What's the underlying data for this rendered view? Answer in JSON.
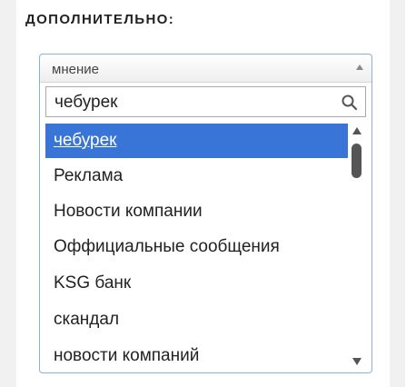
{
  "section": {
    "title": "дополнительно:"
  },
  "select": {
    "value": "мнение"
  },
  "search": {
    "value": "чебурек"
  },
  "results": [
    {
      "label": "чебурек",
      "highlighted": true
    },
    {
      "label": "Реклама"
    },
    {
      "label": "Новости компании"
    },
    {
      "label": "Оффициальные сообщения"
    },
    {
      "label": "KSG банк"
    },
    {
      "label": "скандал"
    },
    {
      "label": "новости компаний"
    }
  ],
  "icons": {
    "search": "search-icon",
    "dropdown": "chevron-up-icon",
    "scroll_up": "scroll-up-arrow-icon",
    "scroll_down": "scroll-down-arrow-icon"
  },
  "colors": {
    "highlight": "#3875d7",
    "select_border": "#8ab0d8"
  }
}
